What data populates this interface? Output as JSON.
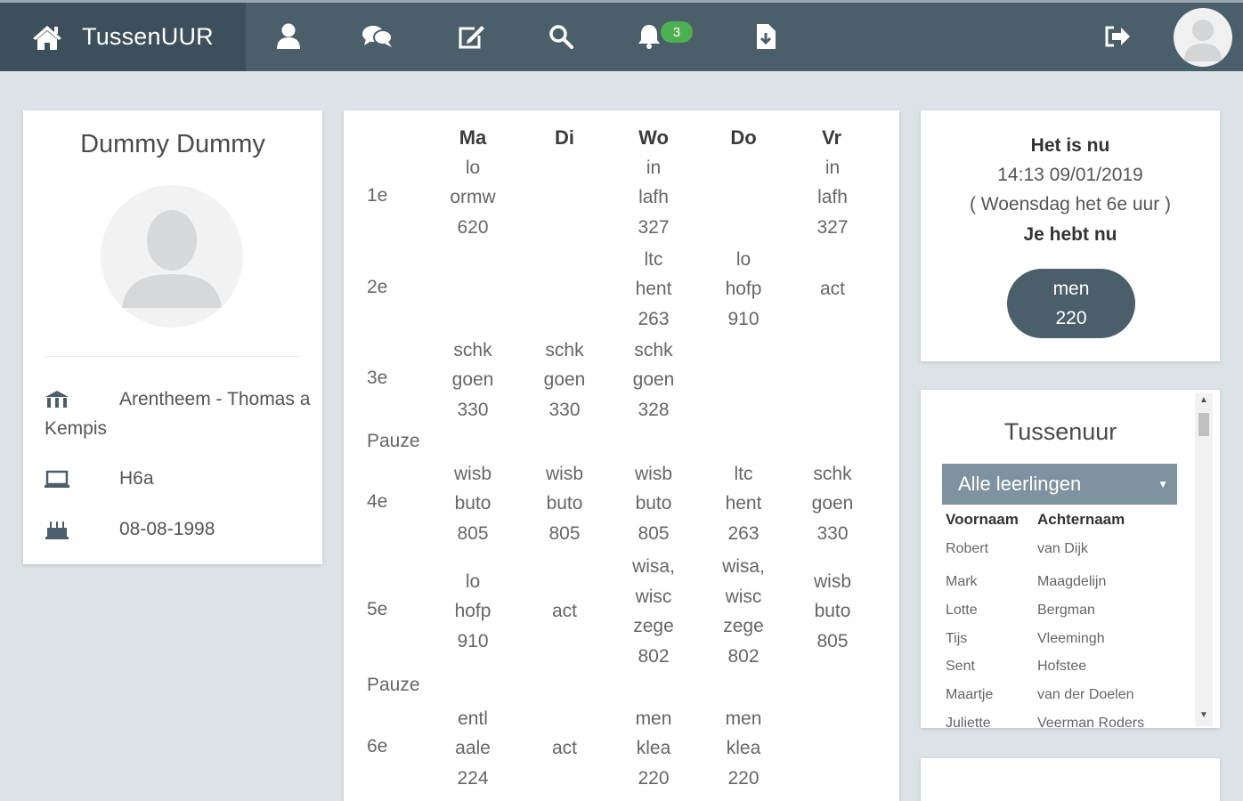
{
  "nav": {
    "brand": "TussenUUR",
    "notification_count": "3"
  },
  "profile": {
    "name": "Dummy Dummy",
    "school": "Arentheem - Thomas a Kempis",
    "class": "H6a",
    "birthdate": "08-08-1998"
  },
  "schedule": {
    "days": [
      "Ma",
      "Di",
      "Wo",
      "Do",
      "Vr"
    ],
    "pause_label": "Pauze",
    "periods": [
      {
        "label": "1e",
        "cells": [
          [
            "lo",
            "ormw",
            "620"
          ],
          [],
          [
            "in",
            "lafh",
            "327"
          ],
          [],
          [
            "in",
            "lafh",
            "327"
          ]
        ]
      },
      {
        "label": "2e",
        "cells": [
          [],
          [],
          [
            "ltc",
            "hent",
            "263"
          ],
          [
            "lo",
            "hofp",
            "910"
          ],
          [
            "act"
          ]
        ]
      },
      {
        "label": "3e",
        "cells": [
          [
            "schk",
            "goen",
            "330"
          ],
          [
            "schk",
            "goen",
            "330"
          ],
          [
            "schk",
            "goen",
            "328"
          ],
          [],
          []
        ]
      },
      {
        "label": "4e",
        "cells": [
          [
            "wisb",
            "buto",
            "805"
          ],
          [
            "wisb",
            "buto",
            "805"
          ],
          [
            "wisb",
            "buto",
            "805"
          ],
          [
            "ltc",
            "hent",
            "263"
          ],
          [
            "schk",
            "goen",
            "330"
          ]
        ]
      },
      {
        "label": "5e",
        "cells": [
          [
            "lo",
            "hofp",
            "910"
          ],
          [
            "act"
          ],
          [
            "wisa,",
            "wisc",
            "zege",
            "802"
          ],
          [
            "wisa,",
            "wisc",
            "zege",
            "802"
          ],
          [
            "wisb",
            "buto",
            "805"
          ]
        ]
      },
      {
        "label": "6e",
        "cells": [
          [
            "entl",
            "aale",
            "224"
          ],
          [
            "act"
          ],
          [
            "men",
            "klea",
            "220"
          ],
          [
            "men",
            "klea",
            "220"
          ],
          []
        ]
      }
    ]
  },
  "now": {
    "title": "Het is nu",
    "datetime": "14:13 09/01/2019",
    "period_note": "( Woensdag het 6e uur )",
    "have_now": "Je hebt nu",
    "subject": "men",
    "room": "220"
  },
  "tussenuur": {
    "title": "Tussenuur",
    "filter": "Alle leerlingen",
    "col_first": "Voornaam",
    "col_last": "Achternaam",
    "students": [
      {
        "first": "Robert",
        "last": "van Dijk"
      },
      {
        "first": "Mark",
        "last": "Maagdelijn"
      },
      {
        "first": "Lotte",
        "last": "Bergman"
      },
      {
        "first": "Tijs",
        "last": "Vleemingh"
      },
      {
        "first": "Sent",
        "last": "Hofstee"
      },
      {
        "first": "Maartje",
        "last": "van der Doelen"
      },
      {
        "first": "Juliette",
        "last": "Veerman Roders"
      }
    ]
  }
}
